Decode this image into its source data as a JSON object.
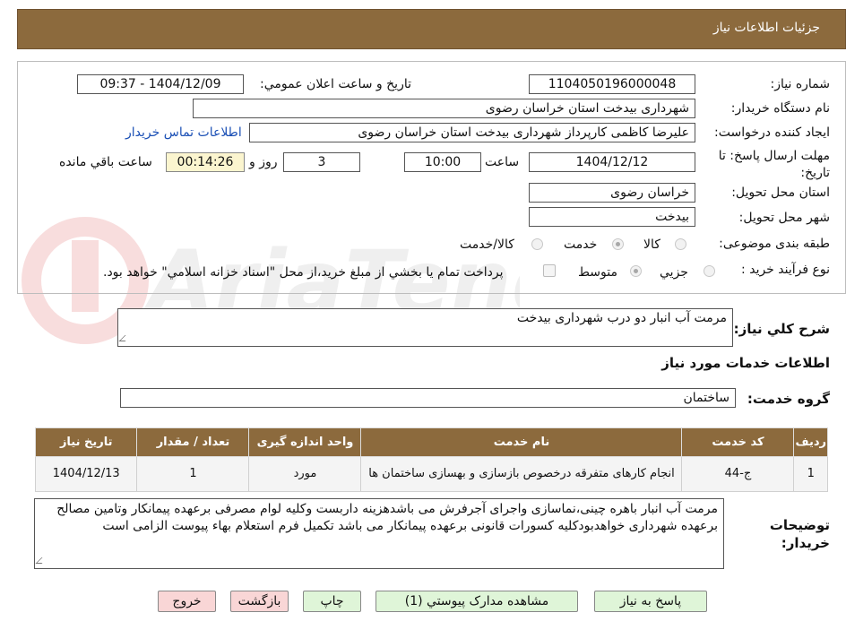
{
  "header": {
    "title": "جزئيات اطلاعات نياز"
  },
  "form": {
    "need_number_label": "شماره نياز:",
    "need_number": "1104050196000048",
    "announce_label": "تاريخ و ساعت اعلان عمومي:",
    "announce_value": "1404/12/09 - 09:37",
    "buyer_org_label": "نام دستگاه خريدار:",
    "buyer_org": "شهرداری بیدخت استان خراسان رضوی",
    "creator_label": "ايجاد کننده درخواست:",
    "creator": "علیرضا کاظمی کارپرداز شهرداری بیدخت استان خراسان رضوی",
    "contact_link": "اطلاعات تماس خريدار",
    "deadline_label": "مهلت ارسال پاسخ: تا تاريخ:",
    "deadline_date": "1404/12/12",
    "time_label": "ساعت",
    "deadline_time": "10:00",
    "days_value": "3",
    "days_label": "روز و",
    "remaining_value": "00:14:26",
    "remaining_label": "ساعت باقي مانده",
    "province_label": "استان محل تحويل:",
    "province": "خراسان رضوی",
    "city_label": "شهر محل تحويل:",
    "city": "بیدخت",
    "category_label": "طبقه بندی موضوعی:",
    "category_options": [
      "کالا",
      "خدمت",
      "کالا/خدمت"
    ],
    "category_selected": "خدمت",
    "process_label": "نوع فرآيند خريد :",
    "process_options": [
      "جزيي",
      "متوسط"
    ],
    "process_selected": "متوسط",
    "payment_note": "پرداخت تمام يا بخشي از مبلغ خريد،از محل \"اسناد خزانه اسلامي\" خواهد بود."
  },
  "summary": {
    "label": "شرح کلي نياز:",
    "value": "مرمت آب انبار دو درب شهرداری بیدخت"
  },
  "services_title": "اطلاعات خدمات مورد نياز",
  "service_group": {
    "label": "گروه خدمت:",
    "value": "ساختمان"
  },
  "table": {
    "headers": [
      "رديف",
      "کد خدمت",
      "نام خدمت",
      "واحد اندازه گيری",
      "تعداد / مقدار",
      "تاريخ نياز"
    ],
    "rows": [
      [
        "1",
        "ج-44",
        "انجام کارهای متفرقه درخصوص بازسازی و بهسازی ساختمان ها",
        "مورد",
        "1",
        "1404/12/13"
      ]
    ]
  },
  "buyer_notes": {
    "label": "توضيحات خريدار:",
    "value": "مرمت آب انبار باهره چینی،نماسازی واجرای آجرفرش می باشدهزینه داربست وکلیه لوام مصرفی برعهده پیمانکار وتامین مصالح برعهده شهرداری خواهدبودکلیه کسورات قانونی برعهده پیمانکار می باشد تکمیل فرم استعلام بهاء پیوست الزامی است"
  },
  "buttons": {
    "respond": "پاسخ به نياز",
    "attachments": "مشاهده مدارک پيوستي (1)",
    "print": "چاپ",
    "back": "بازگشت",
    "exit": "خروج"
  },
  "colors": {
    "header": "#8c6a3d",
    "green_button": "#dff5d8",
    "pink_button": "#f9d6d6",
    "remaining_bg": "#fbf5cf",
    "link": "#1a4fb5"
  }
}
